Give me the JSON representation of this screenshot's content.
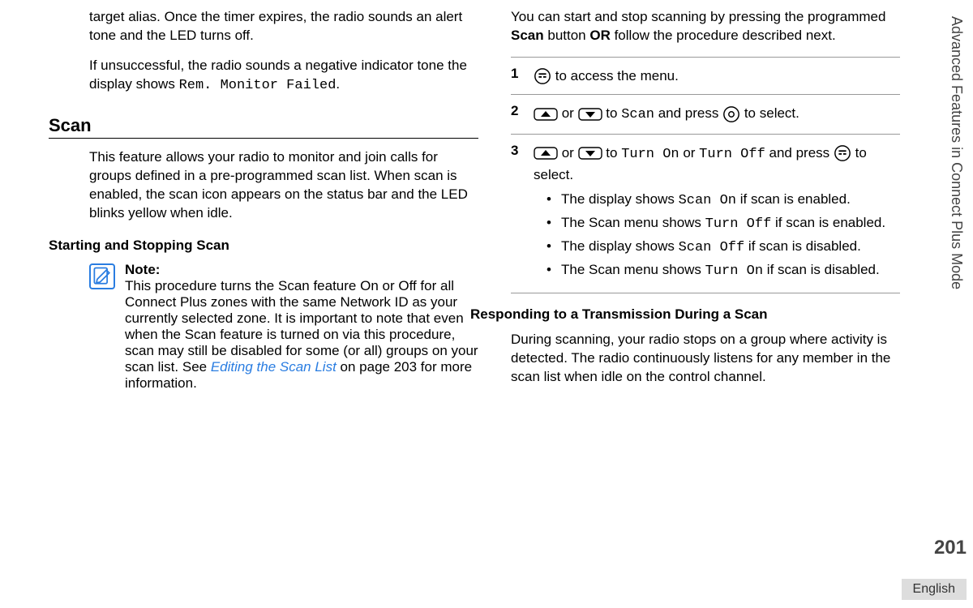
{
  "side_label": "Advanced Features in Connect Plus Mode",
  "page_number": "201",
  "language": "English",
  "left": {
    "para1_a": "target alias. Once the timer expires, the radio sounds an alert tone and the LED turns off.",
    "para2_a": "If unsuccessful, the radio sounds a negative indicator tone the display shows ",
    "para2_code": "Rem. Monitor Failed",
    "para2_b": ".",
    "scan_heading": "Scan",
    "scan_para": "This feature allows your radio to monitor and join calls for groups defined in a pre-programmed scan list. When scan is enabled, the scan icon appears on the status bar and the LED blinks yellow when idle.",
    "start_stop_heading": "Starting and Stopping Scan",
    "note_label": "Note:",
    "note_body_a": "This procedure turns the Scan feature On or Off for all Connect Plus zones with the same Network ID as your currently selected zone. It is important to note that even when the Scan feature is turned on via this procedure, scan may still be disabled for some (or all) groups on your scan list. See ",
    "note_link": "Editing the Scan List",
    "note_body_b": " on page 203 for more information."
  },
  "right": {
    "intro_a": "You can start and stop scanning by pressing the programmed ",
    "intro_scan": "Scan",
    "intro_b": " button ",
    "intro_or": "OR",
    "intro_c": " follow the procedure described next.",
    "step1_num": "1",
    "step1_text": " to access the menu.",
    "step2_num": "2",
    "step2_or": " or ",
    "step2_to": " to ",
    "step2_scan": "Scan",
    "step2_press": " and press ",
    "step2_select": " to select.",
    "step3_num": "3",
    "step3_or": " or ",
    "step3_to": " to ",
    "step3_turnon": "Turn On",
    "step3_mid_or": " or ",
    "step3_turnoff": "Turn Off",
    "step3_press": " and press ",
    "step3_select": " to select.",
    "b1_a": "The display shows ",
    "b1_code": "Scan On",
    "b1_b": " if scan is enabled.",
    "b2_a": "The Scan menu shows ",
    "b2_code": "Turn Off",
    "b2_b": " if scan is enabled.",
    "b3_a": "The display shows ",
    "b3_code": "Scan Off",
    "b3_b": " if scan is disabled.",
    "b4_a": "The Scan menu shows ",
    "b4_code": "Turn On",
    "b4_b": " if scan is disabled.",
    "responding_heading": "Responding to a Transmission During a Scan",
    "responding_para": "During scanning, your radio stops on a group where activity is detected. The radio continuously listens for any member in the scan list when idle on the control channel."
  }
}
